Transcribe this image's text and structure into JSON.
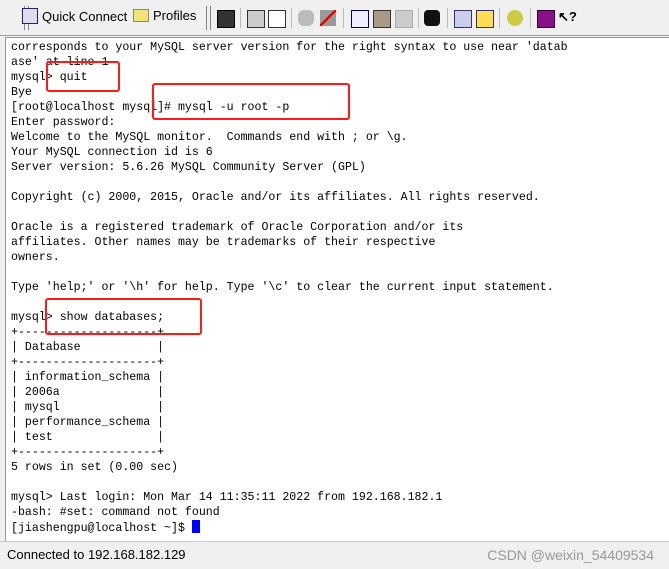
{
  "toolbar": {
    "quick_connect": "Quick Connect",
    "profiles": "Profiles",
    "icons": [
      "quick-connect-icon",
      "profiles-folder-icon",
      "save-icon",
      "print-icon",
      "print-preview-icon",
      "disconnect-icon",
      "reconnect-icon",
      "copy-icon",
      "paste-icon",
      "paste-disabled-icon",
      "find-icon",
      "session-options-icon",
      "global-options-icon",
      "keymap-icon",
      "help-book-icon",
      "context-help-icon"
    ]
  },
  "terminal": {
    "lines": [
      "corresponds to your MySQL server version for the right syntax to use near 'datab",
      "ase' at line 1",
      "mysql> quit",
      "Bye",
      "[root@localhost mysql]# mysql -u root -p",
      "Enter password:",
      "Welcome to the MySQL monitor.  Commands end with ; or \\g.",
      "Your MySQL connection id is 6",
      "Server version: 5.6.26 MySQL Community Server (GPL)",
      "",
      "Copyright (c) 2000, 2015, Oracle and/or its affiliates. All rights reserved.",
      "",
      "Oracle is a registered trademark of Oracle Corporation and/or its",
      "affiliates. Other names may be trademarks of their respective",
      "owners.",
      "",
      "Type 'help;' or '\\h' for help. Type '\\c' to clear the current input statement.",
      "",
      "mysql> show databases;",
      "+--------------------+",
      "| Database           |",
      "+--------------------+",
      "| information_schema |",
      "| 2006a              |",
      "| mysql              |",
      "| performance_schema |",
      "| test               |",
      "+--------------------+",
      "5 rows in set (0.00 sec)",
      "",
      "mysql> Last login: Mon Mar 14 11:35:11 2022 from 192.168.182.1",
      "-bash: #set: command not found",
      "[jiashengpu@localhost ~]$ "
    ],
    "cursor_color": "#0000ff",
    "highlight_color": "#ff1a1a"
  },
  "status": {
    "text": "Connected to 192.168.182.129",
    "watermark": "CSDN @weixin_54409534"
  }
}
